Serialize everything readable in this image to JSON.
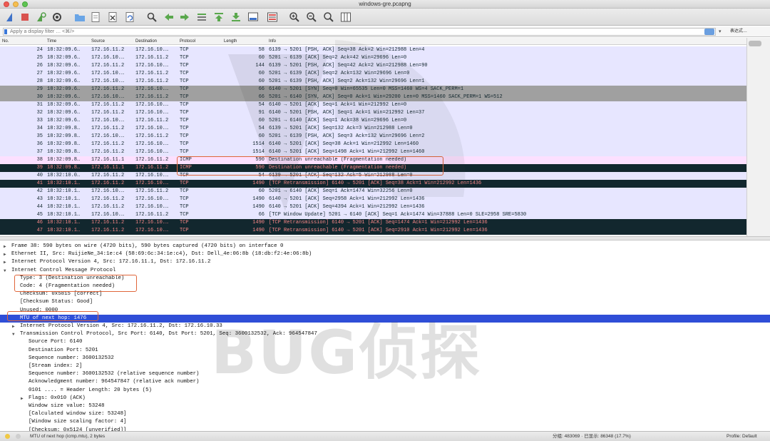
{
  "window": {
    "title": "windows-gre.pcapng"
  },
  "filter": {
    "placeholder": "Apply a display filter … <⌘/>",
    "expression_label": "表达式…"
  },
  "columns": [
    "No.",
    "Time",
    "Source",
    "Destination",
    "Protocol",
    "Length",
    "Info"
  ],
  "packets": [
    {
      "no": "24",
      "time": "18:32:09.6…",
      "src": "172.16.11.2",
      "dst": "172.16.10.…",
      "proto": "TCP",
      "len": "58",
      "info": "6139 → 5201 [PSH, ACK] Seq=38 Ack=2 Win=212988 Len=4",
      "style": "tcp"
    },
    {
      "no": "25",
      "time": "18:32:09.6…",
      "src": "172.16.10.…",
      "dst": "172.16.11.2",
      "proto": "TCP",
      "len": "60",
      "info": "5201 → 6139 [ACK] Seq=2 Ack=42 Win=29696 Len=0",
      "style": "tcp"
    },
    {
      "no": "26",
      "time": "18:32:09.6…",
      "src": "172.16.11.2",
      "dst": "172.16.10.…",
      "proto": "TCP",
      "len": "144",
      "info": "6139 → 5201 [PSH, ACK] Seq=42 Ack=2 Win=212988 Len=90",
      "style": "tcp"
    },
    {
      "no": "27",
      "time": "18:32:09.6…",
      "src": "172.16.10.…",
      "dst": "172.16.11.2",
      "proto": "TCP",
      "len": "60",
      "info": "5201 → 6139 [ACK] Seq=2 Ack=132 Win=29696 Len=0",
      "style": "tcp"
    },
    {
      "no": "28",
      "time": "18:32:09.6…",
      "src": "172.16.10.…",
      "dst": "172.16.11.2",
      "proto": "TCP",
      "len": "60",
      "info": "5201 → 6139 [PSH, ACK] Seq=2 Ack=132 Win=29696 Len=1",
      "style": "tcp"
    },
    {
      "no": "29",
      "time": "18:32:09.6…",
      "src": "172.16.11.2",
      "dst": "172.16.10.…",
      "proto": "TCP",
      "len": "66",
      "info": "6140 → 5201 [SYN] Seq=0 Win=65535 Len=0 MSS=1460 WS=4 SACK_PERM=1",
      "style": "syn"
    },
    {
      "no": "30",
      "time": "18:32:09.6…",
      "src": "172.16.10.…",
      "dst": "172.16.11.2",
      "proto": "TCP",
      "len": "66",
      "info": "5201 → 6140 [SYN, ACK] Seq=0 Ack=1 Win=29200 Len=0 MSS=1460 SACK_PERM=1 WS=512",
      "style": "syn"
    },
    {
      "no": "31",
      "time": "18:32:09.6…",
      "src": "172.16.11.2",
      "dst": "172.16.10.…",
      "proto": "TCP",
      "len": "54",
      "info": "6140 → 5201 [ACK] Seq=1 Ack=1 Win=212992 Len=0",
      "style": "tcp"
    },
    {
      "no": "32",
      "time": "18:32:09.6…",
      "src": "172.16.11.2",
      "dst": "172.16.10.…",
      "proto": "TCP",
      "len": "91",
      "info": "6140 → 5201 [PSH, ACK] Seq=1 Ack=1 Win=212992 Len=37",
      "style": "tcp"
    },
    {
      "no": "33",
      "time": "18:32:09.6…",
      "src": "172.16.10.…",
      "dst": "172.16.11.2",
      "proto": "TCP",
      "len": "60",
      "info": "5201 → 6140 [ACK] Seq=1 Ack=38 Win=29696 Len=0",
      "style": "tcp"
    },
    {
      "no": "34",
      "time": "18:32:09.8…",
      "src": "172.16.11.2",
      "dst": "172.16.10.…",
      "proto": "TCP",
      "len": "54",
      "info": "6139 → 5201 [ACK] Seq=132 Ack=3 Win=212988 Len=0",
      "style": "tcp"
    },
    {
      "no": "35",
      "time": "18:32:09.8…",
      "src": "172.16.10.…",
      "dst": "172.16.11.2",
      "proto": "TCP",
      "len": "60",
      "info": "5201 → 6139 [PSH, ACK] Seq=3 Ack=132 Win=29696 Len=2",
      "style": "tcp"
    },
    {
      "no": "36",
      "time": "18:32:09.8…",
      "src": "172.16.11.2",
      "dst": "172.16.10.…",
      "proto": "TCP",
      "len": "1514",
      "info": "6140 → 5201 [ACK] Seq=38 Ack=1 Win=212992 Len=1460",
      "style": "tcp"
    },
    {
      "no": "37",
      "time": "18:32:09.8…",
      "src": "172.16.11.2",
      "dst": "172.16.10.…",
      "proto": "TCP",
      "len": "1514",
      "info": "6140 → 5201 [ACK] Seq=1498 Ack=1 Win=212992 Len=1460",
      "style": "tcp"
    },
    {
      "no": "38",
      "time": "18:32:09.8…",
      "src": "172.16.11.1",
      "dst": "172.16.11.2",
      "proto": "ICMP",
      "len": "590",
      "info": "Destination unreachable (Fragmentation needed)",
      "style": "icmp"
    },
    {
      "no": "39",
      "time": "18:32:09.8…",
      "src": "172.16.11.1",
      "dst": "172.16.11.2",
      "proto": "ICMP",
      "len": "590",
      "info": "Destination unreachable (Fragmentation needed)",
      "style": "icmpsel"
    },
    {
      "no": "40",
      "time": "18:32:10.0…",
      "src": "172.16.11.2",
      "dst": "172.16.10.…",
      "proto": "TCP",
      "len": "54",
      "info": "6139 → 5201 [ACK] Seq=132 Ack=5 Win=212988 Len=0",
      "style": "tcp"
    },
    {
      "no": "41",
      "time": "18:32:10.1…",
      "src": "172.16.11.2",
      "dst": "172.16.10.…",
      "proto": "TCP",
      "len": "1490",
      "info": "[TCP Retransmission] 6140 → 5201 [ACK] Seq=38 Ack=1 Win=212992 Len=1436",
      "style": "retrans"
    },
    {
      "no": "42",
      "time": "18:32:10.1…",
      "src": "172.16.10.…",
      "dst": "172.16.11.2",
      "proto": "TCP",
      "len": "60",
      "info": "5201 → 6140 [ACK] Seq=1 Ack=1474 Win=32256 Len=0",
      "style": "tcp"
    },
    {
      "no": "43",
      "time": "18:32:10.1…",
      "src": "172.16.11.2",
      "dst": "172.16.10.…",
      "proto": "TCP",
      "len": "1490",
      "info": "6140 → 5201 [ACK] Seq=2958 Ack=1 Win=212992 Len=1436",
      "style": "tcp"
    },
    {
      "no": "44",
      "time": "18:32:10.1…",
      "src": "172.16.11.2",
      "dst": "172.16.10.…",
      "proto": "TCP",
      "len": "1490",
      "info": "6140 → 5201 [ACK] Seq=4394 Ack=1 Win=212992 Len=1436",
      "style": "tcp"
    },
    {
      "no": "45",
      "time": "18:32:10.1…",
      "src": "172.16.10.…",
      "dst": "172.16.11.2",
      "proto": "TCP",
      "len": "66",
      "info": "[TCP Window Update] 5201 → 6140 [ACK] Seq=1 Ack=1474 Win=37888 Len=0 SLE=2958 SRE=5830",
      "style": "tcp"
    },
    {
      "no": "46",
      "time": "18:32:10.1…",
      "src": "172.16.11.2",
      "dst": "172.16.10.…",
      "proto": "TCP",
      "len": "1490",
      "info": "[TCP Retransmission] 6140 → 5201 [ACK] Seq=1474 Ack=1 Win=212992 Len=1436",
      "style": "retrans"
    },
    {
      "no": "47",
      "time": "18:32:10.1…",
      "src": "172.16.11.2",
      "dst": "172.16.10.…",
      "proto": "TCP",
      "len": "1490",
      "info": "[TCP Retransmission] 6140 → 5201 [ACK] Seq=2910 Ack=1 Win=212992 Len=1436",
      "style": "retrans"
    }
  ],
  "row_styles": {
    "tcp": {
      "bg": "#e7e6ff",
      "fg": "#12272e"
    },
    "syn": {
      "bg": "#a0a0a0",
      "fg": "#12272e"
    },
    "icmp": {
      "bg": "#fce0ff",
      "fg": "#12272e"
    },
    "icmpsel": {
      "bg": "#12272e",
      "fg": "#f78787"
    },
    "retrans": {
      "bg": "#12272e",
      "fg": "#f78787"
    }
  },
  "details": [
    {
      "indent": 0,
      "toggle": "▶",
      "text": "Frame 38: 590 bytes on wire (4720 bits), 590 bytes captured (4720 bits) on interface 0"
    },
    {
      "indent": 0,
      "toggle": "▶",
      "text": "Ethernet II, Src: RuijieNe_34:1e:c4 (58:69:6c:34:1e:c4), Dst: Dell_4e:06:8b (18:db:f2:4e:06:8b)"
    },
    {
      "indent": 0,
      "toggle": "▶",
      "text": "Internet Protocol Version 4, Src: 172.16.11.1, Dst: 172.16.11.2"
    },
    {
      "indent": 0,
      "toggle": "▼",
      "text": "Internet Control Message Protocol"
    },
    {
      "indent": 1,
      "toggle": "",
      "text": "Type: 3 (Destination unreachable)"
    },
    {
      "indent": 1,
      "toggle": "",
      "text": "Code: 4 (Fragmentation needed)"
    },
    {
      "indent": 1,
      "toggle": "",
      "text": "Checksum: 0x5815 [correct]"
    },
    {
      "indent": 1,
      "toggle": "",
      "text": "[Checksum Status: Good]"
    },
    {
      "indent": 1,
      "toggle": "",
      "text": "Unused: 0000"
    },
    {
      "indent": 1,
      "toggle": "",
      "text": "MTU of next hop: 1476",
      "selected": true
    },
    {
      "indent": 1,
      "toggle": "▶",
      "text": "Internet Protocol Version 4, Src: 172.16.11.2, Dst: 172.16.10.33"
    },
    {
      "indent": 1,
      "toggle": "▼",
      "text": "Transmission Control Protocol, Src Port: 6140, Dst Port: 5201, Seq: 3600132532, Ack: 964547847"
    },
    {
      "indent": 2,
      "toggle": "",
      "text": "Source Port: 6140"
    },
    {
      "indent": 2,
      "toggle": "",
      "text": "Destination Port: 5201"
    },
    {
      "indent": 2,
      "toggle": "",
      "text": "Sequence number: 3600132532"
    },
    {
      "indent": 2,
      "toggle": "",
      "text": "[Stream index: 2]"
    },
    {
      "indent": 2,
      "toggle": "",
      "text": "Sequence number: 3600132532    (relative sequence number)"
    },
    {
      "indent": 2,
      "toggle": "",
      "text": "Acknowledgment number: 964547847    (relative ack number)"
    },
    {
      "indent": 2,
      "toggle": "",
      "text": "0101 .... = Header Length: 20 bytes (5)"
    },
    {
      "indent": 2,
      "toggle": "▶",
      "text": "Flags: 0x010 (ACK)"
    },
    {
      "indent": 2,
      "toggle": "",
      "text": "Window size value: 53248"
    },
    {
      "indent": 2,
      "toggle": "",
      "text": "[Calculated window size: 53248]"
    },
    {
      "indent": 2,
      "toggle": "",
      "text": "[Window size scaling factor: 4]"
    },
    {
      "indent": 2,
      "toggle": "",
      "text": "[Checksum: 0x5124 [unverified]]"
    }
  ],
  "watermark": {
    "text": "BUG侦探"
  },
  "status": {
    "field": "MTU of next hop (icmp.mtu), 2 bytes",
    "packets": "分组: 483069 · 已显示: 86348 (17.7%)",
    "profile": "Profile: Default"
  }
}
